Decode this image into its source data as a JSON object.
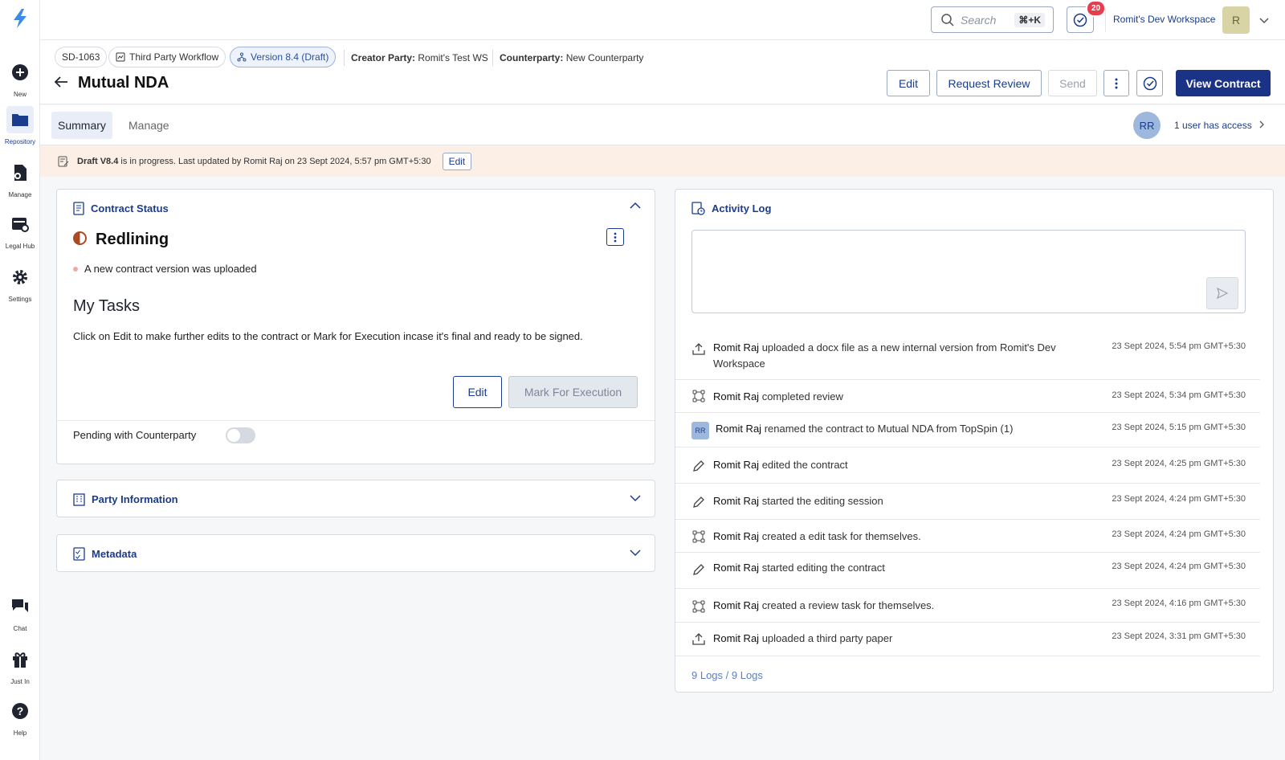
{
  "sidebar": {
    "items": [
      {
        "label": "New",
        "icon": "plus-circle-icon"
      },
      {
        "label": "Repository",
        "icon": "folder-icon"
      },
      {
        "label": "Manage",
        "icon": "manage-file-icon"
      },
      {
        "label": "Legal Hub",
        "icon": "legal-hub-icon"
      },
      {
        "label": "Settings",
        "icon": "gear-icon"
      },
      {
        "label": "Chat",
        "icon": "chat-icon"
      },
      {
        "label": "Just In",
        "icon": "gift-icon"
      },
      {
        "label": "Help",
        "icon": "help-icon"
      }
    ]
  },
  "topbar": {
    "search_placeholder": "Search",
    "search_shortcut": "⌘+K",
    "notifications_count": "20",
    "workspace_name": "Romit's Dev Workspace",
    "avatar_initial": "R"
  },
  "header": {
    "id_chip": "SD-1063",
    "workflow_chip": "Third Party Workflow",
    "version_chip": "Version 8.4 (Draft)",
    "creator_label": "Creator Party:",
    "creator_value": "Romit's Test WS",
    "counterparty_label": "Counterparty:",
    "counterparty_value": "New Counterparty",
    "title": "Mutual NDA",
    "buttons": {
      "edit": "Edit",
      "request_review": "Request Review",
      "send": "Send",
      "view_contract": "View Contract"
    }
  },
  "tabs": {
    "summary": "Summary",
    "manage": "Manage",
    "user_initials": "RR",
    "access_text": "1 user has access"
  },
  "banner": {
    "draft_bold": "Draft V8.4",
    "text": "is in progress. Last updated by Romit Raj on 23 Sept 2024, 5:57 pm GMT+5:30",
    "edit_label": "Edit"
  },
  "contract_status": {
    "title": "Contract Status",
    "status": "Redlining",
    "bullet": "A new contract version was uploaded",
    "tasks_title": "My Tasks",
    "tasks_text": "Click on Edit to make further edits to the contract or Mark for Execution incase it's final and ready to be signed.",
    "edit_button": "Edit",
    "mark_button": "Mark For Execution",
    "pending_label": "Pending with Counterparty"
  },
  "party_info": {
    "title": "Party Information"
  },
  "metadata": {
    "title": "Metadata"
  },
  "activity": {
    "title": "Activity Log",
    "logs": [
      {
        "icon": "upload-icon",
        "actor": "Romit Raj",
        "text": "uploaded a docx file as a new internal version from Romit's Dev Workspace",
        "time": "23 Sept 2024, 5:54 pm GMT+5:30"
      },
      {
        "icon": "workflow-icon",
        "actor": "Romit Raj",
        "text": "completed review",
        "time": "23 Sept 2024, 5:34 pm GMT+5:30"
      },
      {
        "icon": "rr-avatar",
        "actor": "Romit Raj",
        "text": "renamed the contract to Mutual NDA from TopSpin (1)",
        "time": "23 Sept 2024, 5:15 pm GMT+5:30",
        "initials": "RR"
      },
      {
        "icon": "pencil-icon",
        "actor": "Romit Raj",
        "text": "edited the contract",
        "time": "23 Sept 2024, 4:25 pm GMT+5:30"
      },
      {
        "icon": "pencil-icon",
        "actor": "Romit Raj",
        "text": "started the editing session",
        "time": "23 Sept 2024, 4:24 pm GMT+5:30"
      },
      {
        "icon": "workflow-icon",
        "actor": "Romit Raj",
        "text": "created a edit task for themselves.",
        "time": "23 Sept 2024, 4:24 pm GMT+5:30"
      },
      {
        "icon": "pencil-icon",
        "actor": "Romit Raj",
        "text": "started editing the contract",
        "time": "23 Sept 2024, 4:24 pm GMT+5:30"
      },
      {
        "icon": "workflow-icon",
        "actor": "Romit Raj",
        "text": "created a review task for themselves.",
        "time": "23 Sept 2024, 4:16 pm GMT+5:30"
      },
      {
        "icon": "upload-icon",
        "actor": "Romit Raj",
        "text": "uploaded a third party paper",
        "time": "23 Sept 2024, 3:31 pm GMT+5:30"
      }
    ],
    "count_text": "9 Logs / 9 Logs"
  },
  "colors": {
    "brand": "#1a3386",
    "link": "#1a3c8c",
    "banner_bg": "#fcefe6",
    "badge": "#e53e4f"
  }
}
